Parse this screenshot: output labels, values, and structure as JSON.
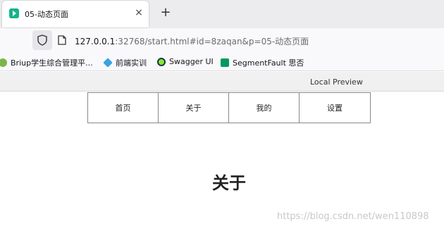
{
  "browser": {
    "tab": {
      "title": "05-动态页面",
      "close_glyph": "×",
      "favicon": "play-icon"
    },
    "new_tab_glyph": "+",
    "address": {
      "host": "127.0.0.1",
      "rest": ":32768/start.html#id=8zaqan&p=05-动态页面"
    },
    "bookmarks": [
      {
        "label": "Briup学生综合管理平...",
        "icon": "briup-icon",
        "color": "#7ab648"
      },
      {
        "label": "前端实训",
        "icon": "cube-icon",
        "color": "#3aa3e3"
      },
      {
        "label": "Swagger UI",
        "icon": "swagger-icon",
        "color": "#85ea2d"
      },
      {
        "label": "SegmentFault 思否",
        "icon": "sf-icon",
        "color": "#009a61"
      }
    ]
  },
  "preview_bar": {
    "label": "Local Preview"
  },
  "nav": {
    "items": [
      {
        "label": "首页"
      },
      {
        "label": "关于"
      },
      {
        "label": "我的"
      },
      {
        "label": "设置"
      }
    ]
  },
  "content": {
    "heading": "关于"
  },
  "watermark": "https://blog.csdn.net/wen110898",
  "colors": {
    "accent": "#15b389",
    "border": "#888888"
  }
}
